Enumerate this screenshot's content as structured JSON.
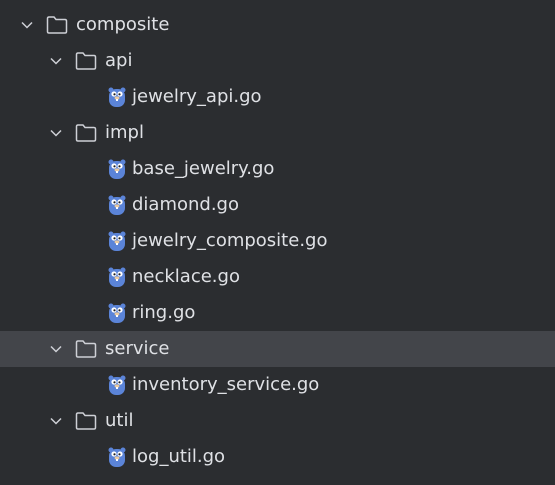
{
  "tree": {
    "root": {
      "label": "composite",
      "icon": "folder-icon",
      "expanded": true
    },
    "api": {
      "label": "api",
      "icon": "folder-icon",
      "expanded": true
    },
    "api_files": [
      {
        "label": "jewelry_api.go",
        "icon": "gopher-icon"
      }
    ],
    "impl": {
      "label": "impl",
      "icon": "folder-icon",
      "expanded": true
    },
    "impl_files": [
      {
        "label": "base_jewelry.go",
        "icon": "gopher-icon"
      },
      {
        "label": "diamond.go",
        "icon": "gopher-icon"
      },
      {
        "label": "jewelry_composite.go",
        "icon": "gopher-icon"
      },
      {
        "label": "necklace.go",
        "icon": "gopher-icon"
      },
      {
        "label": "ring.go",
        "icon": "gopher-icon"
      }
    ],
    "service": {
      "label": "service",
      "icon": "folder-icon",
      "expanded": true,
      "selected": true
    },
    "service_files": [
      {
        "label": "inventory_service.go",
        "icon": "gopher-icon"
      }
    ],
    "util": {
      "label": "util",
      "icon": "folder-icon",
      "expanded": true
    },
    "util_files": [
      {
        "label": "log_util.go",
        "icon": "gopher-icon"
      }
    ]
  },
  "colors": {
    "background": "#2b2d30",
    "selection": "#43454a",
    "text": "#dfe1e5",
    "folder_outline": "#ced0d6",
    "gopher_body": "#5b84d8"
  }
}
